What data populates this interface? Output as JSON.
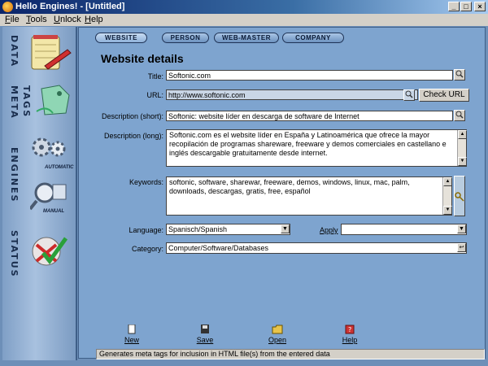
{
  "window": {
    "title": "Hello Engines! - [Untitled]",
    "controls": [
      "_",
      "□",
      "×"
    ]
  },
  "menu": {
    "items": [
      {
        "label": "File",
        "underline": "F",
        "rest": "ile"
      },
      {
        "label": "Tools",
        "underline": "T",
        "rest": "ools"
      },
      {
        "label": "Unlock",
        "underline": "U",
        "rest": "nlock"
      },
      {
        "label": "Help",
        "underline": "H",
        "rest": "elp"
      }
    ]
  },
  "sidebar": {
    "sections": [
      {
        "label": "DATA",
        "icon": "notepad-pen-icon"
      },
      {
        "label": "META TAGS",
        "line1": "META",
        "line2": "TAGS",
        "icon": "tag-icon"
      },
      {
        "label": "ENGINES",
        "icon": "gears-icon",
        "sublabel": "AUTOMATIC"
      },
      {
        "label": "MANUAL",
        "icon": "magnifier-icon",
        "sublabel": "MANUAL"
      },
      {
        "label": "STATUS",
        "icon": "checkmark-icon"
      }
    ]
  },
  "tabs": [
    "WEBSITE",
    "PERSON",
    "WEB-MASTER",
    "COMPANY"
  ],
  "page": {
    "heading": "Website details"
  },
  "form": {
    "title_label": "Title:",
    "title_value": "Softonic.com",
    "url_label": "URL:",
    "url_value": "http://www.softonic.com",
    "check_url_label": "Check URL",
    "desc_short_label": "Description (short):",
    "desc_short_value": "Softonic: website líder en descarga de software de Internet",
    "desc_long_label": "Description (long):",
    "desc_long_value": "Softonic.com es el website líder en España y Latinoamérica que ofrece la mayor recopilación de programas shareware, freeware y demos comerciales en castellano e inglés descargable gratuitamente desde internet.",
    "keywords_label": "Keywords:",
    "keywords_value": "softonic, software, sharewar, freeware, demos, windows, linux, mac, palm, downloads, descargas, gratis, free, español",
    "language_label": "Language:",
    "language_value": "Spanisch/Spanish",
    "apply_label": "Apply",
    "apply_value": "",
    "category_label": "Category:",
    "category_value": "Computer/Software/Databases"
  },
  "toolbar": {
    "new_label": "New",
    "save_label": "Save",
    "open_label": "Open",
    "help_label": "Help"
  },
  "status": {
    "text": "Generates meta tags for inclusion in HTML file(s) from the entered data"
  }
}
